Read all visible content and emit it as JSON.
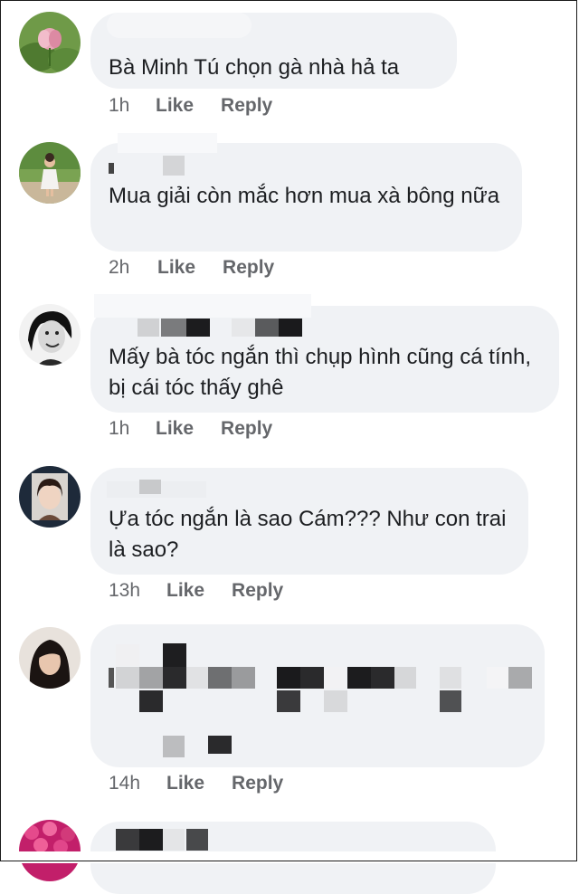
{
  "comments": [
    {
      "author": "",
      "text": "Bà Minh Tú chọn gà nhà hả ta",
      "time": "1h",
      "like": "Like",
      "reply": "Reply"
    },
    {
      "author": "",
      "text": "Mua giải còn mắc hơn mua xà bông nữa",
      "time": "2h",
      "like": "Like",
      "reply": "Reply"
    },
    {
      "author": "",
      "text": "Mấy bà tóc ngắn thì chụp hình cũng cá tính, bị cái tóc thấy ghê",
      "time": "1h",
      "like": "Like",
      "reply": "Reply"
    },
    {
      "author": "",
      "text": "Ựa tóc ngắn là sao Cám??? Như con trai là sao?",
      "time": "13h",
      "like": "Like",
      "reply": "Reply"
    },
    {
      "author": "",
      "text": "",
      "time": "14h",
      "like": "Like",
      "reply": "Reply"
    },
    {
      "author": "",
      "text": ""
    }
  ],
  "colors": {
    "bubble": "#f0f2f5",
    "text": "#1c1e21",
    "meta": "#65676b"
  },
  "icons": [
    "avatar-lotus",
    "avatar-child",
    "avatar-woman-bw",
    "avatar-girl",
    "avatar-woman-dark",
    "avatar-flowers"
  ]
}
